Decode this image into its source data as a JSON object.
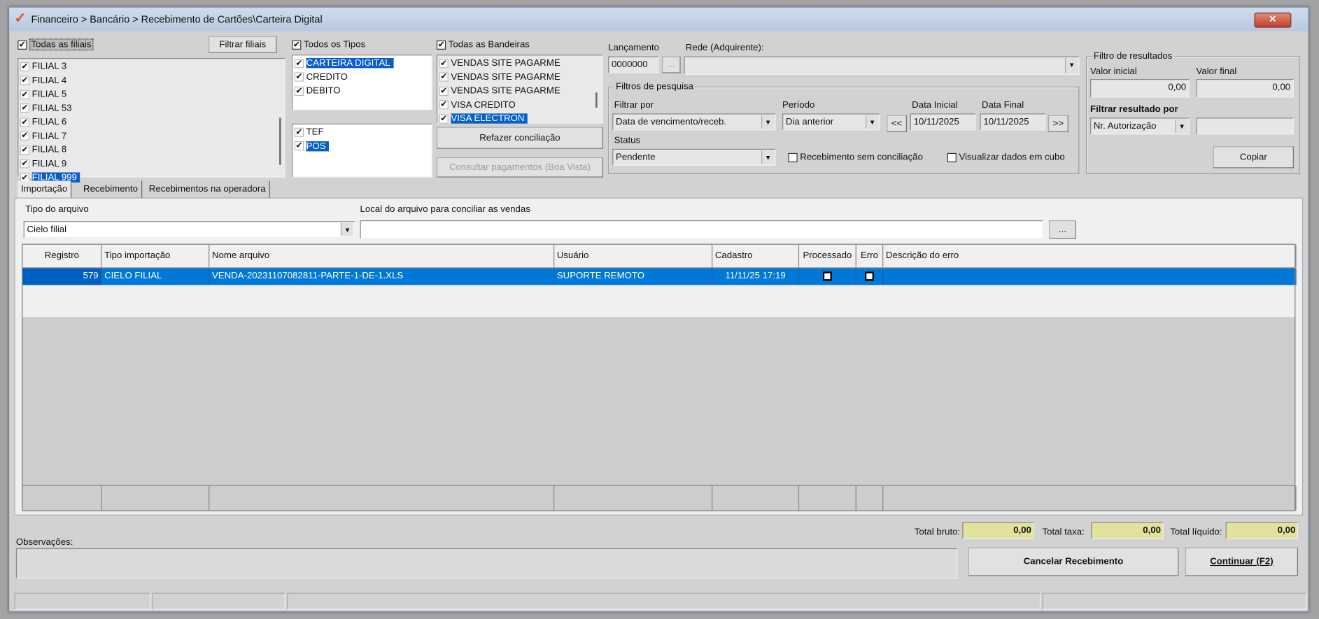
{
  "window": {
    "title": "Financeiro > Bancário > Recebimento de Cartões\\Carteira Digital",
    "close": "✕"
  },
  "filiais": {
    "all_label": "Todas as filiais",
    "filter_button": "Filtrar filiais",
    "items": [
      "FILIAL 3",
      "FILIAL 4",
      "FILIAL 5",
      "FILIAL 53",
      "FILIAL 6",
      "FILIAL 7",
      "FILIAL 8",
      "FILIAL 9",
      "FILIAL 999"
    ]
  },
  "tipos": {
    "all_label": "Todos os Tipos",
    "items": [
      "CARTEIRA DIGITAL",
      "CREDITO",
      "DEBITO"
    ],
    "items2": [
      "TEF",
      "POS"
    ]
  },
  "bandeiras": {
    "all_label": "Todas as Bandeiras",
    "items": [
      "VENDAS SITE PAGARME",
      "VENDAS SITE PAGARME",
      "VENDAS SITE PAGARME",
      "VISA CREDITO",
      "VISA ELECTRON"
    ],
    "refazer": "Refazer conciliação",
    "consultar": "Consultar pagamentos (Boa Vista)"
  },
  "lancamento": {
    "label": "Lançamento",
    "value": "0000000",
    "dots": "...",
    "rede_label": "Rede (Adquirente):",
    "rede_value": ""
  },
  "filtros": {
    "title": "Filtros de pesquisa",
    "filtrar_por_label": "Filtrar por",
    "filtrar_por": "Data de vencimento/receb.",
    "periodo_label": "Período",
    "periodo": "Dia anterior",
    "prev": "<<",
    "next": ">>",
    "data_inicial_label": "Data Inicial",
    "data_inicial": "10/11/2025",
    "data_final_label": "Data Final",
    "data_final": "10/11/2025",
    "status_label": "Status",
    "status": "Pendente",
    "sem_conciliacao": "Recebimento sem conciliação",
    "cubo": "Visualizar dados em cubo"
  },
  "resultados": {
    "title": "Filtro de resultados",
    "valor_inicial_label": "Valor inicial",
    "valor_inicial": "0,00",
    "valor_final_label": "Valor final",
    "valor_final": "0,00",
    "filtrar_por_label": "Filtrar resultado por",
    "filtrar_por": "Nr. Autorização",
    "filtro_valor": "",
    "copiar": "Copiar"
  },
  "tabs": [
    "Importação",
    "Recebimento",
    "Recebimentos na operadora"
  ],
  "importacao": {
    "tipo_label": "Tipo do arquivo",
    "tipo": "Cielo filial",
    "local_label": "Local do arquivo para conciliar as vendas",
    "local": "",
    "dots": "..."
  },
  "grid": {
    "columns": [
      "Registro",
      "Tipo importação",
      "Nome arquivo",
      "Usuário",
      "Cadastro",
      "Processado",
      "Erro",
      "Descrição do erro"
    ],
    "rows": [
      {
        "registro": "579",
        "tipo": "CIELO FILIAL",
        "nome": "VENDA-20231107082811-PARTE-1-DE-1.XLS",
        "usuario": "SUPORTE REMOTO",
        "cadastro": "11/11/25 17:19",
        "processado": false,
        "erro": false,
        "descricao": ""
      }
    ]
  },
  "totals": {
    "bruto_label": "Total bruto:",
    "bruto": "0,00",
    "taxa_label": "Total taxa:",
    "taxa": "0,00",
    "liquido_label": "Total líquido:",
    "liquido": "0,00"
  },
  "obs": {
    "label": "Observações:",
    "value": ""
  },
  "actions": {
    "cancelar": "Cancelar Recebimento",
    "continuar": "Continuar (F2)"
  },
  "colors": {
    "selection": "#0078d7",
    "totals": "#e2e29e"
  }
}
